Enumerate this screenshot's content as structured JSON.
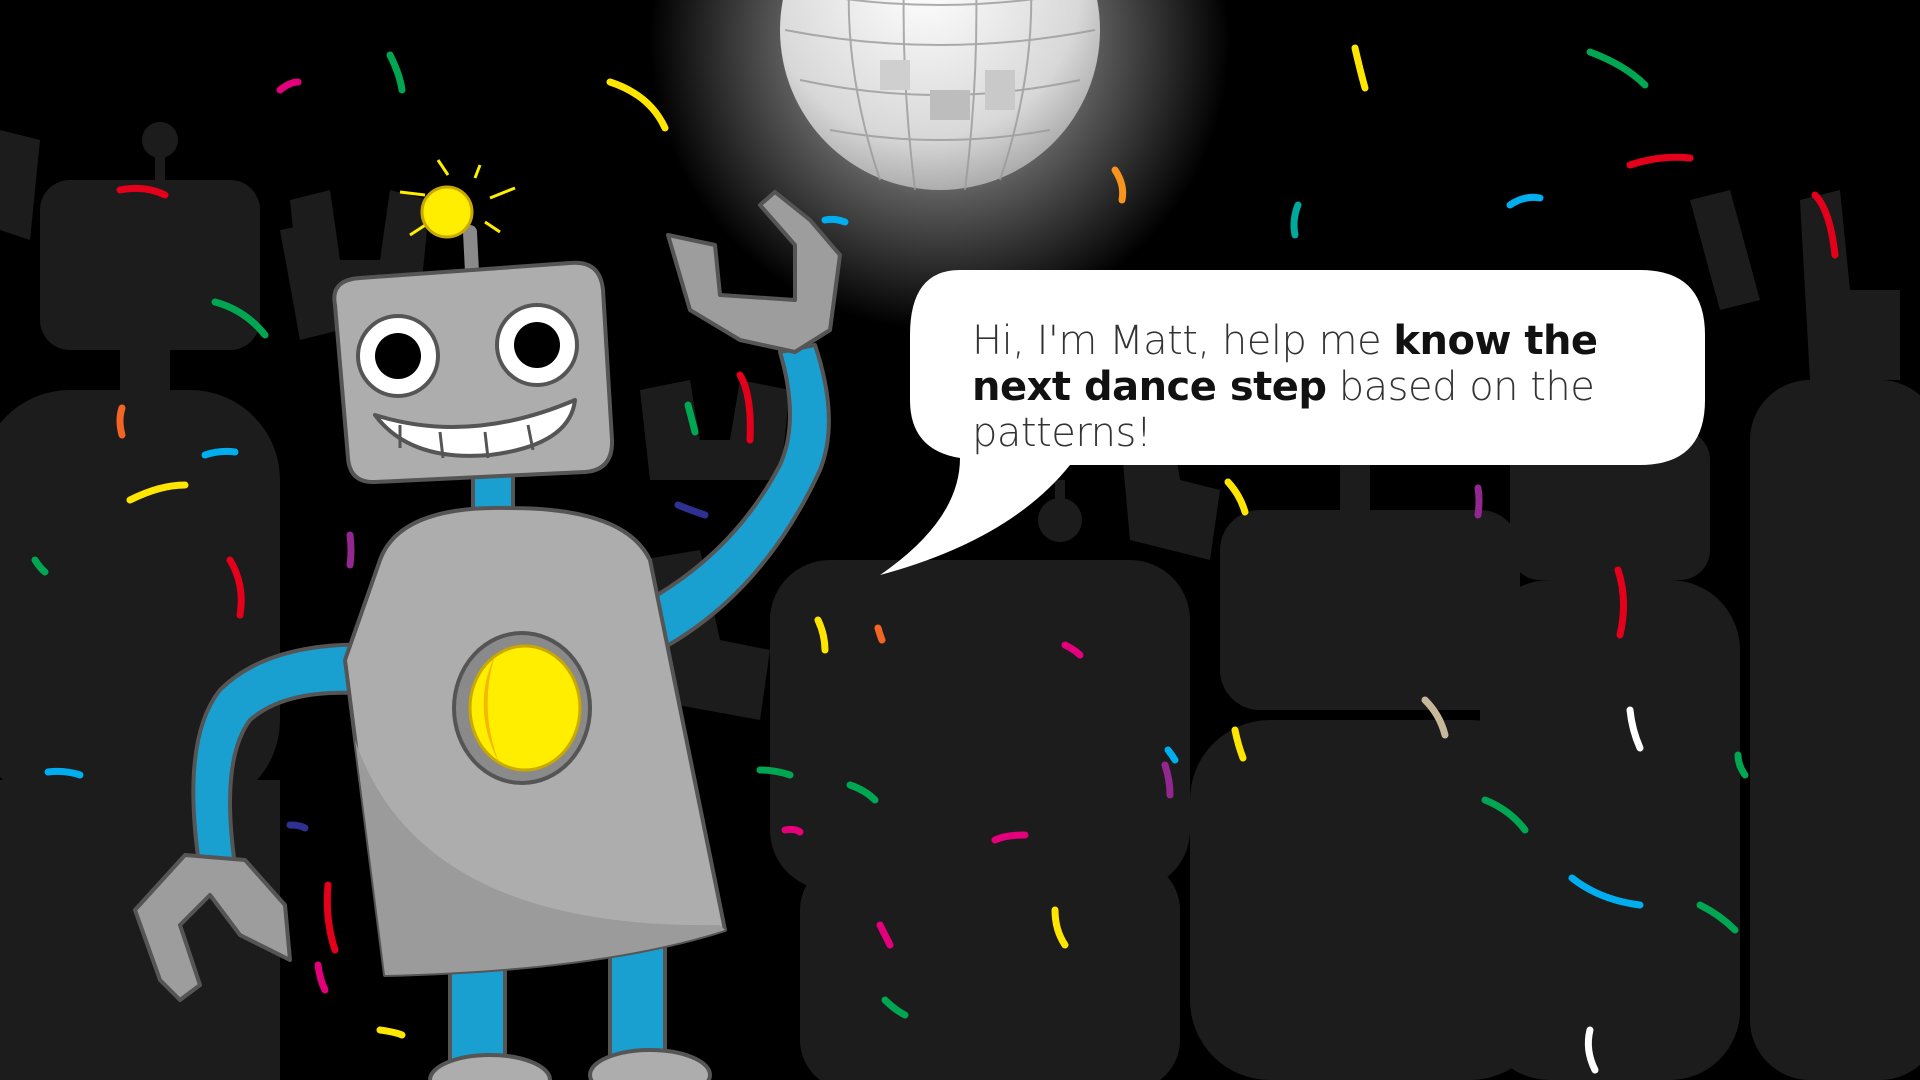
{
  "speech": {
    "intro": "Hi, I'm Matt, help me ",
    "emphasis": "know the next dance step",
    "outro": " based on the patterns!"
  },
  "characters": {
    "robot": {
      "name_shown": "Matt",
      "eye_icon": "robot-eye-icon",
      "light_icon": "antenna-light-icon"
    }
  },
  "colors": {
    "background": "#000000",
    "crowd": "#1c1c1c",
    "robot_body": "#adadad",
    "robot_limbs": "#1aa0d0",
    "robot_core": "#ffee00",
    "bubble": "#ffffff"
  }
}
